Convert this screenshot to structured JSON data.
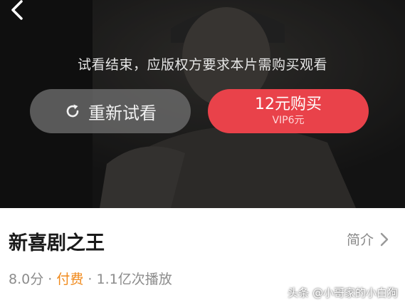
{
  "player": {
    "notice": "试看结束，应版权方要求本片需购买观看",
    "retry_label": "重新试看",
    "buy_label": "12元购买",
    "vip_label": "VIP6元"
  },
  "info": {
    "title": "新喜剧之王",
    "intro_label": "简介",
    "rating": "8.0分",
    "sep1": " · ",
    "paid": "付费",
    "sep2": " · ",
    "plays": "1.1亿次播放"
  },
  "watermark": "头条 @小哥家的小白狗",
  "colors": {
    "accent": "#e9424a",
    "paid": "#f08a1c"
  }
}
